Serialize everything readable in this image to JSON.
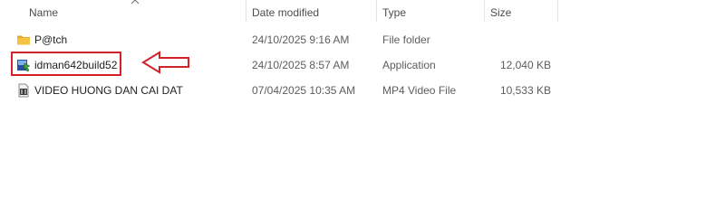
{
  "columns": {
    "name": "Name",
    "date_modified": "Date modified",
    "type": "Type",
    "size": "Size"
  },
  "files": [
    {
      "name": "P@tch",
      "date": "24/10/2025 9:16 AM",
      "type": "File folder",
      "size": "",
      "icon": "folder-icon"
    },
    {
      "name": "idman642build52",
      "date": "24/10/2025 8:57 AM",
      "type": "Application",
      "size": "12,040 KB",
      "icon": "application-icon"
    },
    {
      "name": "VIDEO HUONG DAN CAI DAT",
      "date": "07/04/2025 10:35 AM",
      "type": "MP4 Video File",
      "size": "10,533 KB",
      "icon": "video-file-icon"
    }
  ],
  "colors": {
    "folder": "#f5c244",
    "annotation": "#d42029"
  }
}
